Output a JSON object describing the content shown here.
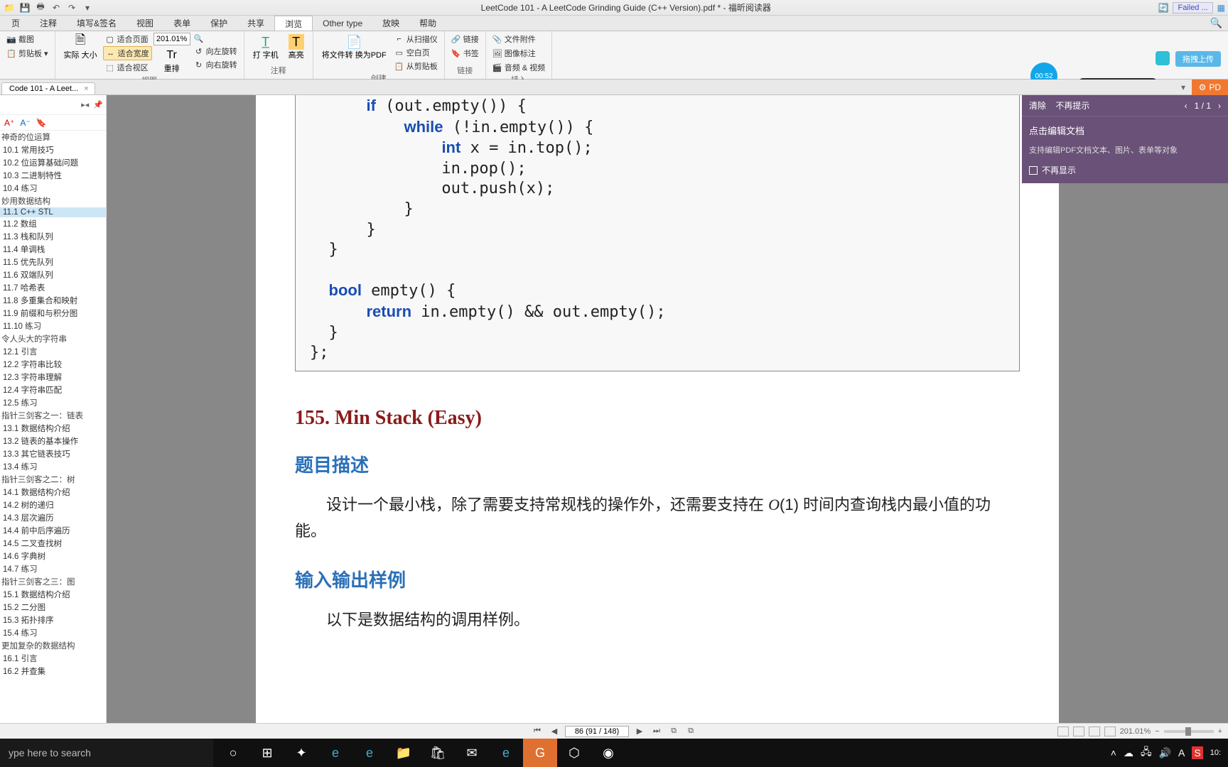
{
  "title": "LeetCode 101 - A LeetCode Grinding Guide (C++ Version).pdf * - 福昕阅读器",
  "failed": "Failed ...",
  "menu": {
    "file": "页",
    "comment": "注释",
    "fill": "填写&签名",
    "view": "视图",
    "form": "表单",
    "protect": "保护",
    "share": "共享",
    "browse": "浏览",
    "other": "Other type",
    "play": "放映",
    "help": "帮助"
  },
  "ribbon": {
    "clip": {
      "screenshot": "截图",
      "clipboard": "剪贴板"
    },
    "zoom": {
      "actual": "实际\n大小",
      "fitpage": "适合页面",
      "fitwidth": "适合宽度",
      "fitview": "适合视区",
      "value": "201.01%",
      "reflow": "重排",
      "rotleft": "向左旋转",
      "rotright": "向右旋转",
      "group": "视图"
    },
    "typewriter": {
      "label": "打\n字机",
      "highlight": "高亮",
      "group": "注释"
    },
    "convert": {
      "label": "将文件转\n换为PDF"
    },
    "create": {
      "scan": "从扫描仪",
      "blank": "空白页",
      "clip": "从剪贴板",
      "group": "创建"
    },
    "links": {
      "link": "链接",
      "bookmark": "书签",
      "group": "链接"
    },
    "insert": {
      "attach": "文件附件",
      "imgnote": "图像标注",
      "av": "音频 & 视频",
      "group": "插入"
    }
  },
  "upload": "拖拽上传",
  "timer": "00:52",
  "doctab": "Code 101 - A Leet...",
  "pdf_badge": "PD",
  "toc": [
    {
      "t": "神奇的位运算",
      "s": true
    },
    {
      "t": "10.1 常用技巧"
    },
    {
      "t": "10.2 位运算基础问题"
    },
    {
      "t": "10.3 二进制特性"
    },
    {
      "t": "10.4 练习"
    },
    {
      "t": "妙用数据结构",
      "s": true
    },
    {
      "t": "11.1 C++ STL",
      "sel": true
    },
    {
      "t": "11.2 数组"
    },
    {
      "t": "11.3 栈和队列"
    },
    {
      "t": "11.4 单调栈"
    },
    {
      "t": "11.5 优先队列"
    },
    {
      "t": "11.6 双端队列"
    },
    {
      "t": "11.7 哈希表"
    },
    {
      "t": "11.8 多重集合和映射"
    },
    {
      "t": "11.9 前缀和与积分图"
    },
    {
      "t": "11.10 练习"
    },
    {
      "t": "令人头大的字符串",
      "s": true
    },
    {
      "t": "12.1 引言"
    },
    {
      "t": "12.2 字符串比较"
    },
    {
      "t": "12.3 字符串理解"
    },
    {
      "t": "12.4 字符串匹配"
    },
    {
      "t": "12.5 练习"
    },
    {
      "t": "指针三剑客之一：链表",
      "s": true
    },
    {
      "t": "13.1 数据结构介绍"
    },
    {
      "t": "13.2 链表的基本操作"
    },
    {
      "t": "13.3 其它链表技巧"
    },
    {
      "t": "13.4 练习"
    },
    {
      "t": "指针三剑客之二：树",
      "s": true
    },
    {
      "t": "14.1 数据结构介绍"
    },
    {
      "t": "14.2 树的递归"
    },
    {
      "t": "14.3 层次遍历"
    },
    {
      "t": "14.4 前中后序遍历"
    },
    {
      "t": "14.5 二叉查找树"
    },
    {
      "t": "14.6 字典树"
    },
    {
      "t": "14.7 练习"
    },
    {
      "t": "指针三剑客之三：图",
      "s": true
    },
    {
      "t": "15.1 数据结构介绍"
    },
    {
      "t": "15.2 二分图"
    },
    {
      "t": "15.3 拓扑排序"
    },
    {
      "t": "15.4 练习"
    },
    {
      "t": "更加复杂的数据结构",
      "s": true
    },
    {
      "t": "16.1 引言"
    },
    {
      "t": "16.2 并查集"
    }
  ],
  "code": "      if (out.empty()) {\n          while (!in.empty()) {\n              int x = in.top();\n              in.pop();\n              out.push(x);\n          }\n      }\n  }\n\n  bool empty() {\n      return in.empty() && out.empty();\n  }\n};",
  "problem": "155. Min Stack (Easy)",
  "sec1": "题目描述",
  "body1a": "设计一个最小栈，除了需要支持常规栈的操作外，还需要支持在 ",
  "body1b": "(1) 时间内查询栈内最小值的功能。",
  "sec2": "输入输出样例",
  "body2": "以下是数据结构的调用样例。",
  "popup": {
    "clear": "清除",
    "dontprompt": "不再提示",
    "counter": "1 / 1",
    "edit": "点击编辑文档",
    "desc": "支持编辑PDF文档文本、图片、表单等对象",
    "noshow": "不再显示"
  },
  "nav": {
    "page": "86 (91 / 148)",
    "zoom": "201.01%"
  },
  "taskbar": {
    "search": "ype here to search",
    "time": "10:"
  }
}
